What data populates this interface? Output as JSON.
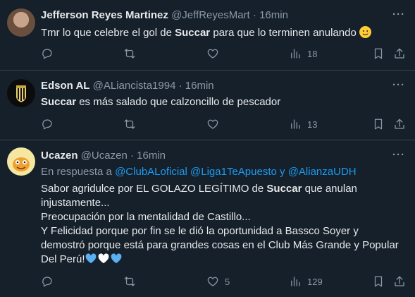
{
  "tweets": [
    {
      "name": "Jefferson Reyes Martinez",
      "handle": "@JeffReyesMart",
      "sep": "·",
      "time": "16min",
      "more": "···",
      "text_parts": [
        "Tmr lo que celebre el gol de ",
        "Succar",
        " para que lo terminen anulando "
      ],
      "views": "18",
      "emoji": "smiling-face-with-tear"
    },
    {
      "name": "Edson AL",
      "handle": "@ALiancista1994",
      "sep": "·",
      "time": "16min",
      "more": "···",
      "text_parts": [
        "Succar",
        " es más salado que calzoncillo de pescador"
      ],
      "views": "13"
    },
    {
      "name": "Ucazen",
      "handle": "@Ucazen",
      "sep": "·",
      "time": "16min",
      "more": "···",
      "reply_prefix": "En respuesta a ",
      "reply_links": [
        "@ClubALoficial",
        "@Liga1TeApuesto",
        "@AlianzaUDH"
      ],
      "reply_and": " y ",
      "lines": [
        [
          "Sabor agridulce por EL GOLAZO LEGÍTIMO de ",
          "Succar",
          " que anulan"
        ],
        [
          "injustamente..."
        ],
        [
          "Preocupación por la mentalidad de Castillo..."
        ],
        [
          "Y Felicidad porque por fin se le dió la oportunidad a Bassco Soyer y"
        ],
        [
          "demostró porque está para grandes cosas en el Club Más Grande y Popular"
        ],
        [
          "Del Perú!"
        ]
      ],
      "hearts": [
        "#5ab0f0",
        "#ffffff",
        "#5ab0f0"
      ],
      "likes": "5",
      "views": "129"
    }
  ],
  "colors": {
    "background": "#15202b",
    "text": "#e7e9ea",
    "muted": "#8b98a5",
    "link": "#1d9bf0",
    "divider": "#38444d"
  },
  "icons": [
    "reply-icon",
    "retweet-icon",
    "like-icon",
    "views-icon",
    "bookmark-icon",
    "share-icon"
  ]
}
